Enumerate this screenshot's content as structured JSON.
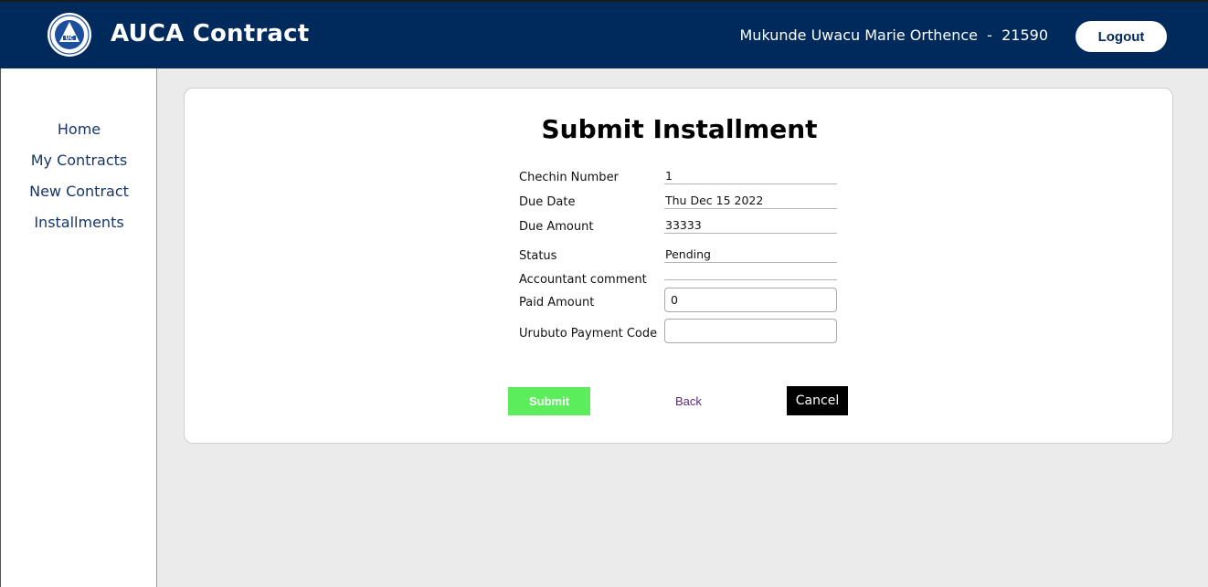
{
  "header": {
    "app_title": "AUCA Contract",
    "user": "Mukunde Uwacu Marie Orthence  -  21590",
    "logout_label": "Logout",
    "logo_icon": "auca-logo-icon",
    "bg_color": "#002a5c"
  },
  "sidebar": {
    "items": [
      {
        "label": "Home"
      },
      {
        "label": "My Contracts"
      },
      {
        "label": "New Contract"
      },
      {
        "label": "Installments"
      }
    ]
  },
  "main": {
    "title": "Submit Installment",
    "fields": {
      "checkin_number": {
        "label": "Chechin Number",
        "value": "1"
      },
      "due_date": {
        "label": "Due Date",
        "value": "Thu Dec 15 2022"
      },
      "due_amount": {
        "label": "Due Amount",
        "value": "33333"
      },
      "status": {
        "label": "Status",
        "value": "Pending"
      },
      "accountant_comment": {
        "label": "Accountant comment",
        "value": ""
      },
      "paid_amount": {
        "label": "Paid Amount",
        "value": "0"
      },
      "payment_code": {
        "label": "Urubuto Payment Code",
        "value": ""
      }
    },
    "actions": {
      "submit_label": "Submit",
      "back_label": "Back",
      "cancel_label": "Cancel"
    },
    "colors": {
      "submit": "#5ced5c",
      "cancel": "#000000"
    }
  }
}
